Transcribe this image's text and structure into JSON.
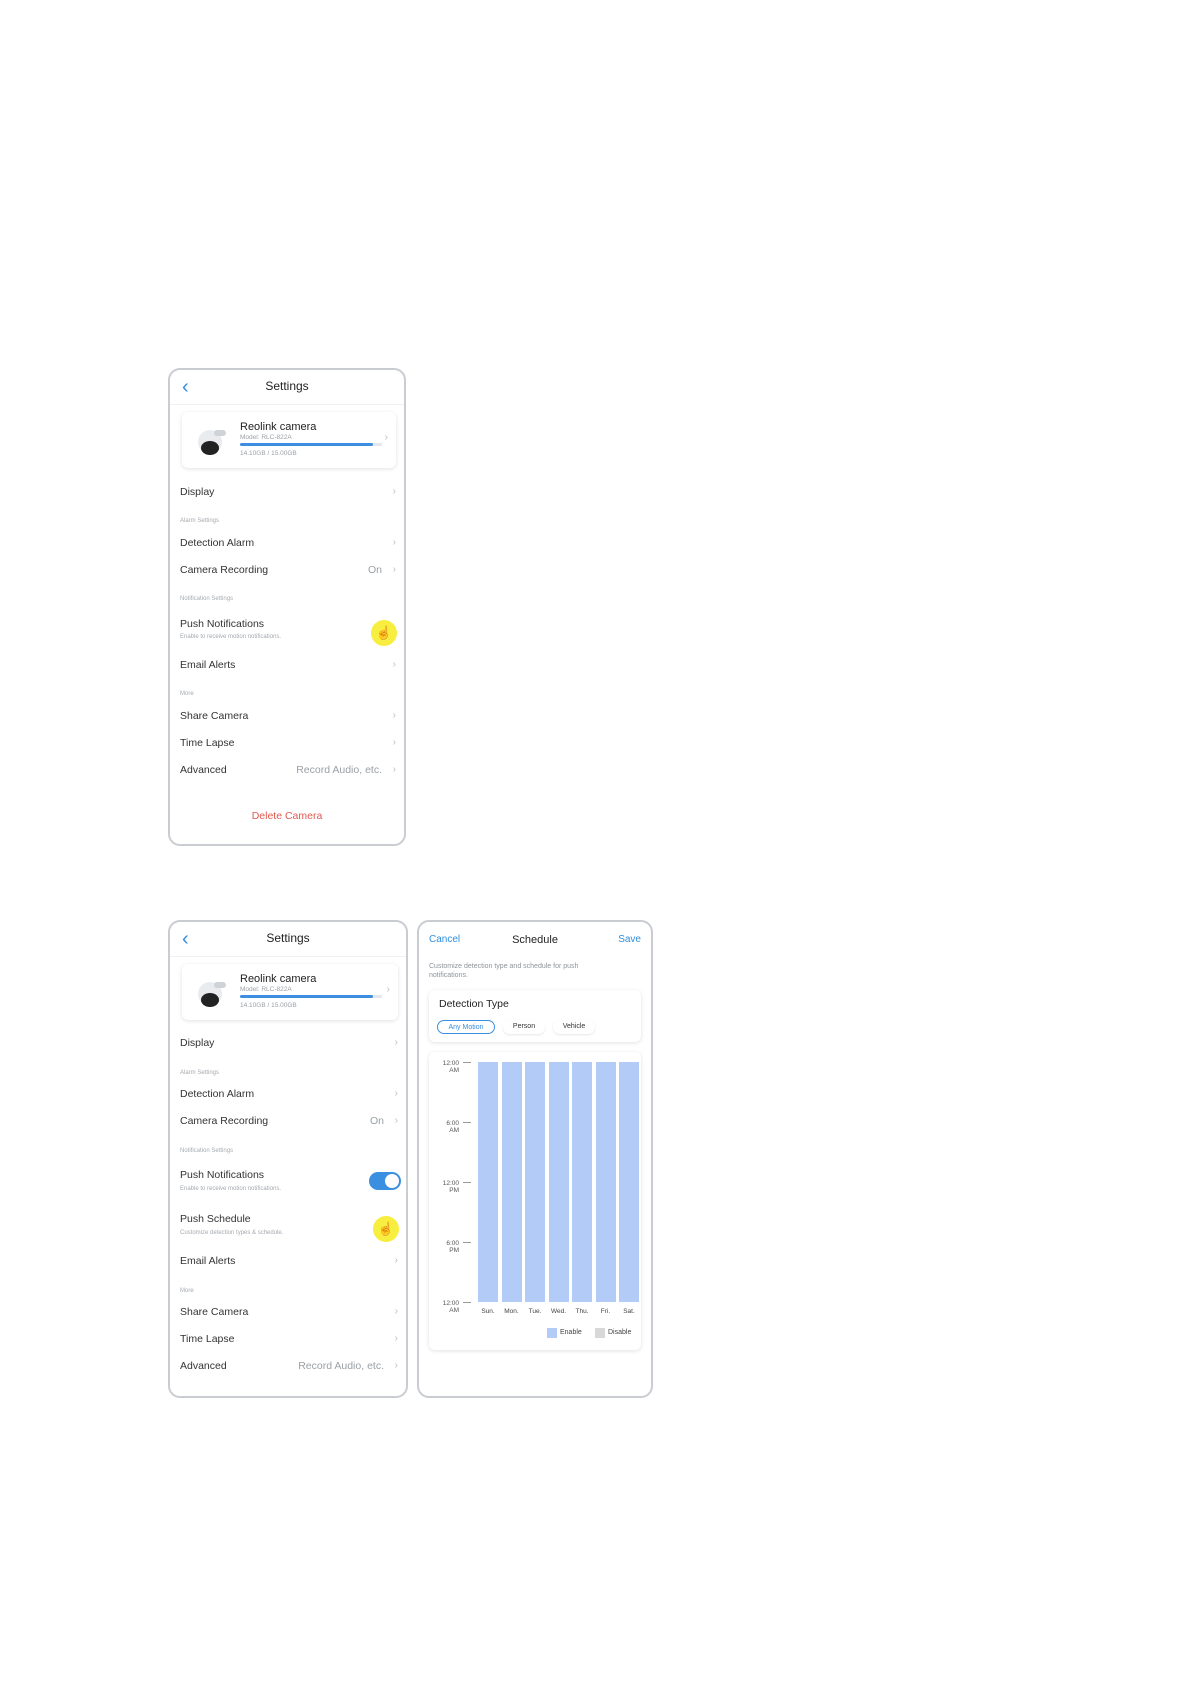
{
  "screen1": {
    "nav_title": "Settings",
    "camera": {
      "name": "Reolink camera",
      "model": "Model: RLC-822A",
      "storage": "14.10GB / 15.00GB",
      "storage_used_fraction": 0.94
    },
    "rows": [
      {
        "label": "Display"
      },
      {
        "label": "Detection Alarm"
      },
      {
        "label": "Camera Recording",
        "value": "On"
      },
      {
        "label": "Push Notifications",
        "sub": "Enable to receive motion notifications."
      },
      {
        "label": "Email Alerts"
      },
      {
        "label": "Share Camera"
      },
      {
        "label": "Time Lapse"
      },
      {
        "label": "Advanced",
        "value": "Record Audio, etc."
      }
    ],
    "sections": {
      "alarm": "Alarm Settings",
      "notification": "Notification Settings",
      "more": "More"
    },
    "delete": "Delete Camera"
  },
  "screen2": {
    "nav_title": "Settings",
    "camera": {
      "name": "Reolink camera",
      "model": "Model: RLC-822A",
      "storage": "14.10GB / 15.00GB",
      "storage_used_fraction": 0.94
    },
    "rows": [
      {
        "label": "Display"
      },
      {
        "label": "Detection Alarm"
      },
      {
        "label": "Camera Recording",
        "value": "On"
      },
      {
        "label": "Push Notifications",
        "sub": "Enable to receive motion notifications.",
        "toggle": true
      },
      {
        "label": "Push Schedule",
        "sub": "Customize detection types & schedule."
      },
      {
        "label": "Email Alerts"
      },
      {
        "label": "Share Camera"
      },
      {
        "label": "Time Lapse"
      },
      {
        "label": "Advanced",
        "value": "Record Audio, etc."
      }
    ],
    "sections": {
      "alarm": "Alarm Settings",
      "notification": "Notification Settings",
      "more": "More"
    }
  },
  "schedule": {
    "cancel": "Cancel",
    "title": "Schedule",
    "save": "Save",
    "description": "Customize detection type and schedule for push notifications.",
    "detection_type_title": "Detection Type",
    "chips": [
      "Any Motion",
      "Person",
      "Vehicle"
    ],
    "time_ticks": [
      {
        "time": "12:00",
        "ampm": "AM"
      },
      {
        "time": "6:00",
        "ampm": "AM"
      },
      {
        "time": "12:00",
        "ampm": "PM"
      },
      {
        "time": "6:00",
        "ampm": "PM"
      },
      {
        "time": "12:00",
        "ampm": "AM"
      }
    ],
    "days": [
      "Sun.",
      "Mon.",
      "Tue.",
      "Wed.",
      "Thu.",
      "Fri.",
      "Sat."
    ],
    "legend": {
      "enable": "Enable",
      "disable": "Disable"
    },
    "colors": {
      "enable": "#b3cbf7",
      "disable": "#d8d8d8",
      "accent": "#3b8fe0"
    }
  }
}
